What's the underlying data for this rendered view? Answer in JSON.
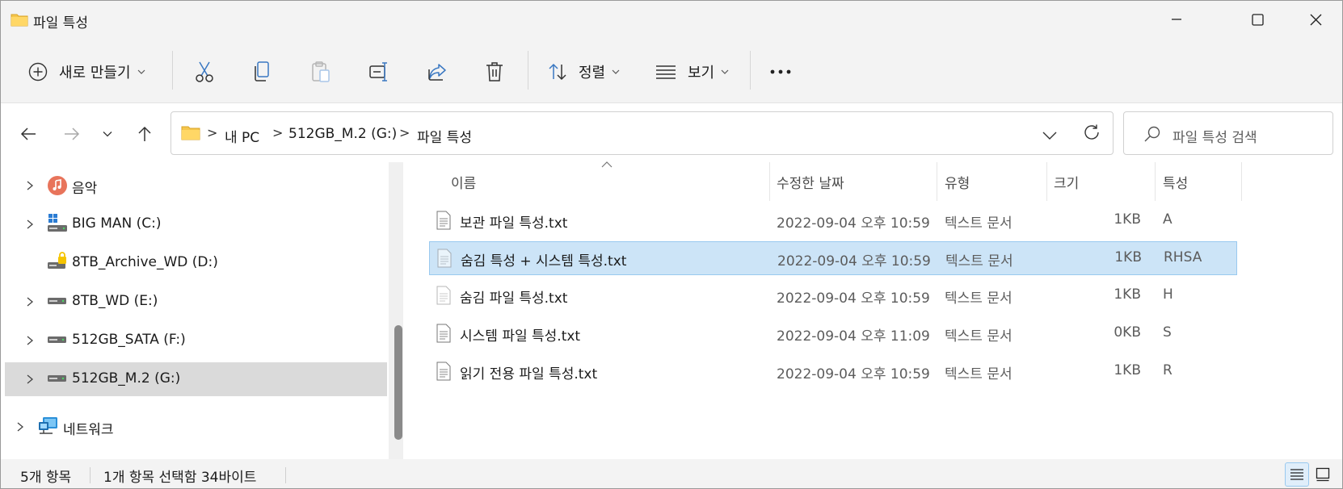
{
  "window": {
    "title": "파일 특성",
    "controls": [
      "minimize-icon",
      "maximize-icon",
      "close-icon"
    ]
  },
  "toolbar": {
    "new_label": "새로 만들기",
    "sort_label": "정렬",
    "view_label": "보기",
    "icons": [
      "plus-circle-icon",
      "cut-icon",
      "copy-icon",
      "paste-icon",
      "rename-icon",
      "share-icon",
      "delete-icon",
      "sort-icon",
      "view-icon",
      "more-icon"
    ]
  },
  "nav": {
    "breadcrumbs": [
      "내 PC",
      "512GB_M.2 (G:)",
      "파일 특성"
    ],
    "separator": ">",
    "search_placeholder": "파일 특성 검색"
  },
  "tree": {
    "items": [
      {
        "label": "음악",
        "icon": "music-icon",
        "expandable": true
      },
      {
        "label": "BIG MAN (C:)",
        "icon": "system-drive-icon",
        "expandable": true
      },
      {
        "label": "8TB_Archive_WD (D:)",
        "icon": "locked-drive-icon",
        "expandable": false
      },
      {
        "label": "8TB_WD (E:)",
        "icon": "drive-icon",
        "expandable": true
      },
      {
        "label": "512GB_SATA (F:)",
        "icon": "drive-icon",
        "expandable": true
      },
      {
        "label": "512GB_M.2 (G:)",
        "icon": "drive-icon",
        "expandable": true,
        "selected": true
      },
      {
        "label": "네트워크",
        "icon": "network-icon",
        "expandable": true
      }
    ]
  },
  "list": {
    "columns": [
      "이름",
      "수정한 날짜",
      "유형",
      "크기",
      "특성"
    ],
    "rows": [
      {
        "name": "보관 파일 특성.txt",
        "date": "2022-09-04 오후 10:59",
        "type": "텍스트 문서",
        "size": "1KB",
        "attr": "A",
        "selected": false
      },
      {
        "name": "숨김 특성 + 시스템 특성.txt",
        "date": "2022-09-04 오후 10:59",
        "type": "텍스트 문서",
        "size": "1KB",
        "attr": "RHSA",
        "selected": true
      },
      {
        "name": "숨김 파일 특성.txt",
        "date": "2022-09-04 오후 10:59",
        "type": "텍스트 문서",
        "size": "1KB",
        "attr": "H",
        "selected": false
      },
      {
        "name": "시스템 파일 특성.txt",
        "date": "2022-09-04 오후 11:09",
        "type": "텍스트 문서",
        "size": "0KB",
        "attr": "S",
        "selected": false
      },
      {
        "name": "읽기 전용 파일 특성.txt",
        "date": "2022-09-04 오후 10:59",
        "type": "텍스트 문서",
        "size": "1KB",
        "attr": "R",
        "selected": false
      }
    ]
  },
  "status": {
    "count": "5개 항목",
    "selection": "1개 항목 선택함 34바이트"
  },
  "colors": {
    "selection_bg": "#cce4f7",
    "selection_border": "#99c9ef",
    "folder": "#f5c64c",
    "tree_selected": "#dadada"
  }
}
